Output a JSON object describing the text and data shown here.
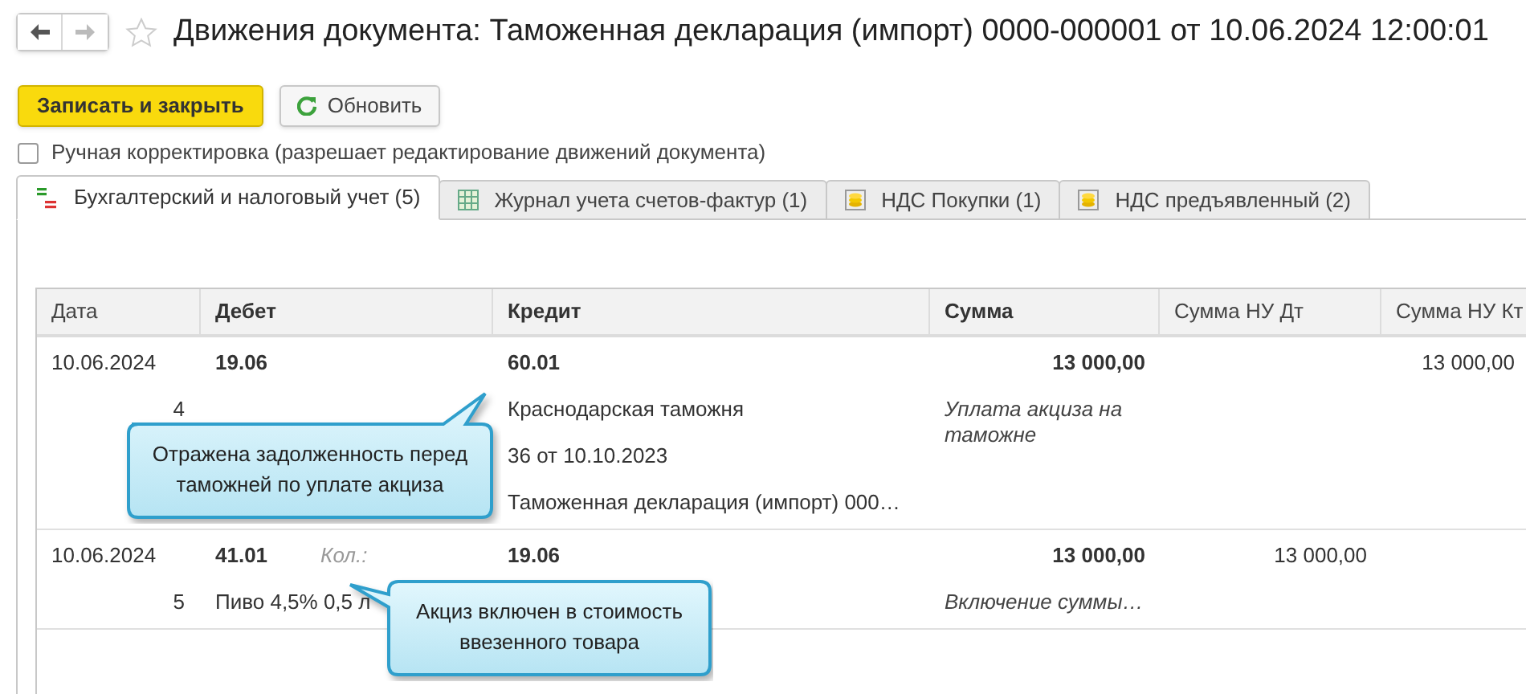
{
  "window": {
    "title": "Движения документа: Таможенная декларация (импорт) 0000-000001 от 10.06.2024 12:00:01",
    "favorite": false
  },
  "toolbar": {
    "buttons": [
      {
        "label": "Записать и закрыть",
        "kind": "primary"
      },
      {
        "label": "Обновить",
        "kind": "refresh"
      }
    ]
  },
  "manual_edit": {
    "label": "Ручная корректировка (разрешает редактирование движений документа)",
    "checked": false
  },
  "tabs": [
    {
      "label": "Бухгалтерский и налоговый учет (5)",
      "selected": true,
      "kind": "dtkt"
    },
    {
      "label": "Журнал учета счетов-фактур (1)",
      "selected": false,
      "kind": "grid"
    },
    {
      "label": "НДС Покупки (1)",
      "selected": false,
      "kind": "coins"
    },
    {
      "label": "НДС предъявленный (2)",
      "selected": false,
      "kind": "coins"
    }
  ],
  "table": {
    "columns": [
      "Дата",
      "Дебет",
      "Кредит",
      "Сумма",
      "Сумма НУ Дт",
      "Сумма НУ Кт"
    ],
    "rows": [
      {
        "cells": [
          [
            [
              {
                "text": "10.06.2024",
                "kind": "plain"
              }
            ],
            [
              {
                "text": "4",
                "kind": "count"
              }
            ]
          ],
          [
            [
              {
                "text": "19.06",
                "kind": "bold"
              }
            ]
          ],
          [
            [
              {
                "text": "60.01",
                "kind": "bold"
              }
            ],
            [
              {
                "text": "Краснодарская таможня",
                "kind": "plain"
              }
            ],
            [
              {
                "text": "36 от 10.10.2023",
                "kind": "plain"
              }
            ],
            [
              {
                "text": "Таможенная декларация (импорт) 000…",
                "kind": "plain"
              }
            ]
          ],
          [
            [
              {
                "text": "13 000,00",
                "kind": "amount_bold"
              }
            ],
            [
              {
                "text": "Уплата акциза на таможне",
                "kind": "italic"
              }
            ]
          ],
          [],
          [
            [
              {
                "text": "13 000,00",
                "kind": "amount"
              }
            ]
          ]
        ]
      },
      {
        "cells": [
          [
            [
              {
                "text": "10.06.2024",
                "kind": "plain"
              }
            ],
            [
              {
                "text": "5",
                "kind": "count"
              }
            ]
          ],
          [
            [
              {
                "text": "41.01",
                "kind": "bold"
              },
              {
                "text": "Кол.:",
                "kind": "note"
              }
            ],
            [
              {
                "text": "Пиво 4,5% 0,5 л",
                "kind": "plain"
              }
            ]
          ],
          [
            [
              {
                "text": "19.06",
                "kind": "bold"
              }
            ]
          ],
          [
            [
              {
                "text": "13 000,00",
                "kind": "amount_bold"
              }
            ],
            [
              {
                "text": "Включение суммы…",
                "kind": "italic"
              }
            ]
          ],
          [
            [
              {
                "text": "13 000,00",
                "kind": "amount"
              }
            ]
          ],
          []
        ]
      }
    ]
  },
  "callouts": [
    {
      "text": "Отражена задолженность перед таможней по уплате акциза"
    },
    {
      "text": "Акциз включен в стоимость ввезенного товара"
    }
  ]
}
